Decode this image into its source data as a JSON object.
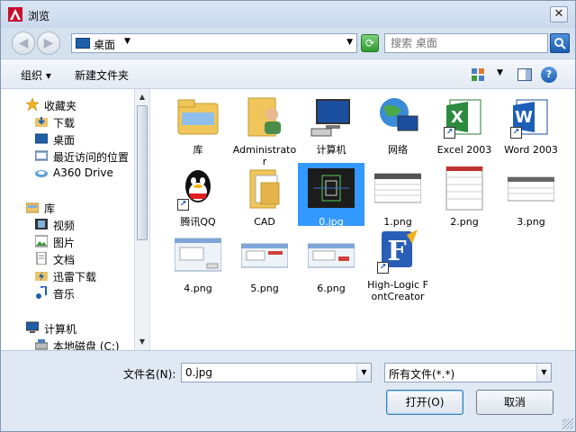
{
  "window": {
    "title": "浏览",
    "close_label": "✕"
  },
  "address": {
    "location": "桌面",
    "search_placeholder": "搜索 桌面"
  },
  "toolbar": {
    "organize": "组织 ▾",
    "new_folder": "新建文件夹",
    "help": "?"
  },
  "nav": {
    "items": [
      {
        "label": "收藏夹",
        "icon": "star-icon"
      },
      {
        "label": "下载",
        "icon": "download-folder-icon"
      },
      {
        "label": "桌面",
        "icon": "desktop-icon"
      },
      {
        "label": "最近访问的位置",
        "icon": "recent-places-icon"
      },
      {
        "label": "A360 Drive",
        "icon": "cloud-drive-icon"
      },
      {
        "label": "库",
        "icon": "library-icon"
      },
      {
        "label": "视频",
        "icon": "video-icon"
      },
      {
        "label": "图片",
        "icon": "picture-icon"
      },
      {
        "label": "文档",
        "icon": "document-icon"
      },
      {
        "label": "迅雷下载",
        "icon": "thunder-download-icon"
      },
      {
        "label": "音乐",
        "icon": "music-icon"
      },
      {
        "label": "计算机",
        "icon": "computer-icon"
      },
      {
        "label": "本地磁盘 (C:)",
        "icon": "local-disk-icon"
      }
    ]
  },
  "files": [
    {
      "name": "库",
      "icon": "library-folder-icon"
    },
    {
      "name": "Administrator",
      "icon": "user-folder-icon"
    },
    {
      "name": "计算机",
      "icon": "computer-icon"
    },
    {
      "name": "网络",
      "icon": "network-icon"
    },
    {
      "name": "Excel 2003",
      "icon": "excel-icon"
    },
    {
      "name": "Word 2003",
      "icon": "word-icon"
    },
    {
      "name": "腾讯QQ",
      "icon": "qq-icon"
    },
    {
      "name": "CAD",
      "icon": "folder-icon"
    },
    {
      "name": "0.jpg",
      "icon": "cad-image-thumbnail"
    },
    {
      "name": "1.png",
      "icon": "spreadsheet-thumbnail"
    },
    {
      "name": "2.png",
      "icon": "spreadsheet-thumbnail"
    },
    {
      "name": "3.png",
      "icon": "spreadsheet-thumbnail"
    },
    {
      "name": "4.png",
      "icon": "dialog-thumbnail"
    },
    {
      "name": "5.png",
      "icon": "dialog-thumbnail"
    },
    {
      "name": "6.png",
      "icon": "dialog-thumbnail"
    },
    {
      "name": "High-Logic FontCreator",
      "icon": "fontcreator-icon"
    }
  ],
  "bottom": {
    "filename_label": "文件名(N):",
    "filename_value": "0.jpg",
    "filetype_value": "所有文件(*.*)",
    "open_label": "打开(O)",
    "cancel_label": "取消"
  },
  "colors": {
    "selection": "#3399ff",
    "window_bg": "#d4e1ef"
  }
}
